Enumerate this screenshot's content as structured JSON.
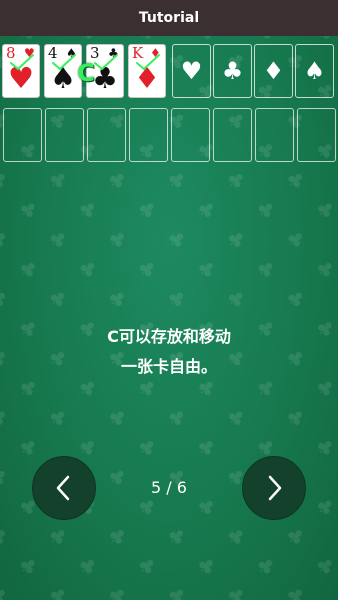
{
  "header": {
    "title": "Tutorial"
  },
  "free_cells": [
    {
      "rank": "8",
      "suit": "♥",
      "color": "red"
    },
    {
      "rank": "4",
      "suit": "♠",
      "color": "black"
    },
    {
      "rank": "3",
      "suit": "♣",
      "color": "black"
    },
    {
      "rank": "K",
      "suit": "♦",
      "color": "red"
    }
  ],
  "highlight_marker": "C",
  "foundations": [
    "♥",
    "♣",
    "♦",
    "♠"
  ],
  "tutorial": {
    "line1": "C可以存放和移动",
    "line2": "一张卡自由。"
  },
  "pager": {
    "text": "5 / 6"
  },
  "icons": {
    "prev": "chevron-left-icon",
    "next": "chevron-right-icon",
    "check": "check-mark-icon"
  },
  "colors": {
    "felt": "#17794f",
    "titlebar": "#3b2f31",
    "nav_button": "#13412c",
    "card_red": "#e0202a",
    "check_green": "#35f05a"
  }
}
